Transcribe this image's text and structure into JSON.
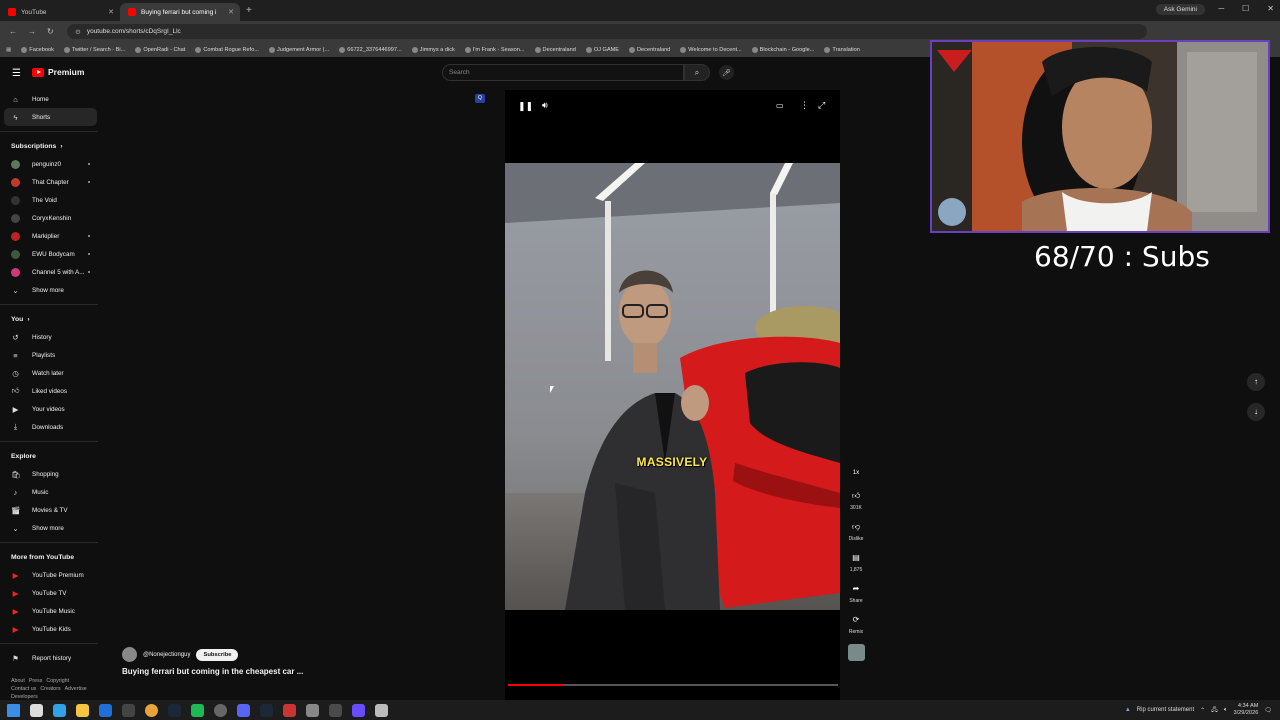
{
  "browser": {
    "tabs": [
      {
        "label": "YouTube",
        "active": false
      },
      {
        "label": "Buying ferrari but coming i",
        "active": true
      }
    ],
    "ask_gemini": "Ask Gemini",
    "url": "youtube.com/shorts/cDqSrgI_Llc",
    "bookmarks": [
      "Facebook",
      "Twitter / Search - Bi...",
      "OpenRadi - Chat",
      "Combat Rogue Refo...",
      "Judgement Armor (...",
      "66722_3376446997...",
      "Jimmys a dick",
      "I'm Frank - Season...",
      "Decentraland",
      "OJ GAME",
      "Decentraland",
      "Welcome to Decent...",
      "Blockchain - Google...",
      "Translation"
    ]
  },
  "youtube": {
    "logo_text": "Premium",
    "search_placeholder": "Search",
    "sidebar": {
      "main": [
        {
          "label": "Home",
          "icon": "home-icon"
        },
        {
          "label": "Shorts",
          "icon": "shorts-icon",
          "active": true
        }
      ],
      "subscriptions_title": "Subscriptions",
      "subscriptions": [
        {
          "label": "penguinz0",
          "dot": true
        },
        {
          "label": "That Chapter",
          "dot": true
        },
        {
          "label": "The Void",
          "dot": false
        },
        {
          "label": "CoryxKenshin",
          "dot": false
        },
        {
          "label": "Markiplier",
          "dot": true
        },
        {
          "label": "EWU Bodycam",
          "dot": true
        },
        {
          "label": "Channel 5 with A...",
          "dot": true
        }
      ],
      "show_more": "Show more",
      "you_title": "You",
      "you": [
        {
          "label": "History",
          "icon": "history-icon"
        },
        {
          "label": "Playlists",
          "icon": "playlists-icon"
        },
        {
          "label": "Watch later",
          "icon": "watch-later-icon"
        },
        {
          "label": "Liked videos",
          "icon": "like-icon"
        },
        {
          "label": "Your videos",
          "icon": "your-videos-icon"
        },
        {
          "label": "Downloads",
          "icon": "download-icon"
        }
      ],
      "explore_title": "Explore",
      "explore": [
        {
          "label": "Shopping",
          "icon": "shopping-icon"
        },
        {
          "label": "Music",
          "icon": "music-icon"
        },
        {
          "label": "Movies & TV",
          "icon": "movies-icon"
        }
      ],
      "more_title": "More from YouTube",
      "more": [
        {
          "label": "YouTube Premium"
        },
        {
          "label": "YouTube TV"
        },
        {
          "label": "YouTube Music"
        },
        {
          "label": "YouTube Kids"
        }
      ],
      "report_history": "Report history",
      "footer_row1": [
        "About",
        "Press",
        "Copyright"
      ],
      "footer_row2": [
        "Contact us",
        "Creators",
        "Advertise"
      ],
      "footer_row3": [
        "Developers"
      ]
    },
    "short": {
      "caption": "MASSIVELY",
      "channel": "@Nonejectionguy",
      "subscribe": "Subscribe",
      "title": "Buying ferrari but coming in the cheapest car ...",
      "playback_rate": "1x",
      "likes": "301K",
      "dislike_label": "Dislike",
      "comments": "1,875",
      "share_label": "Share",
      "remix_label": "Remix",
      "progress_fraction": 0.17
    }
  },
  "overlay": {
    "subs_counter": "68/70 : Subs"
  },
  "taskbar": {
    "notification": "Rip current statement",
    "time": "4:34 AM",
    "date": "3/29/2026"
  }
}
